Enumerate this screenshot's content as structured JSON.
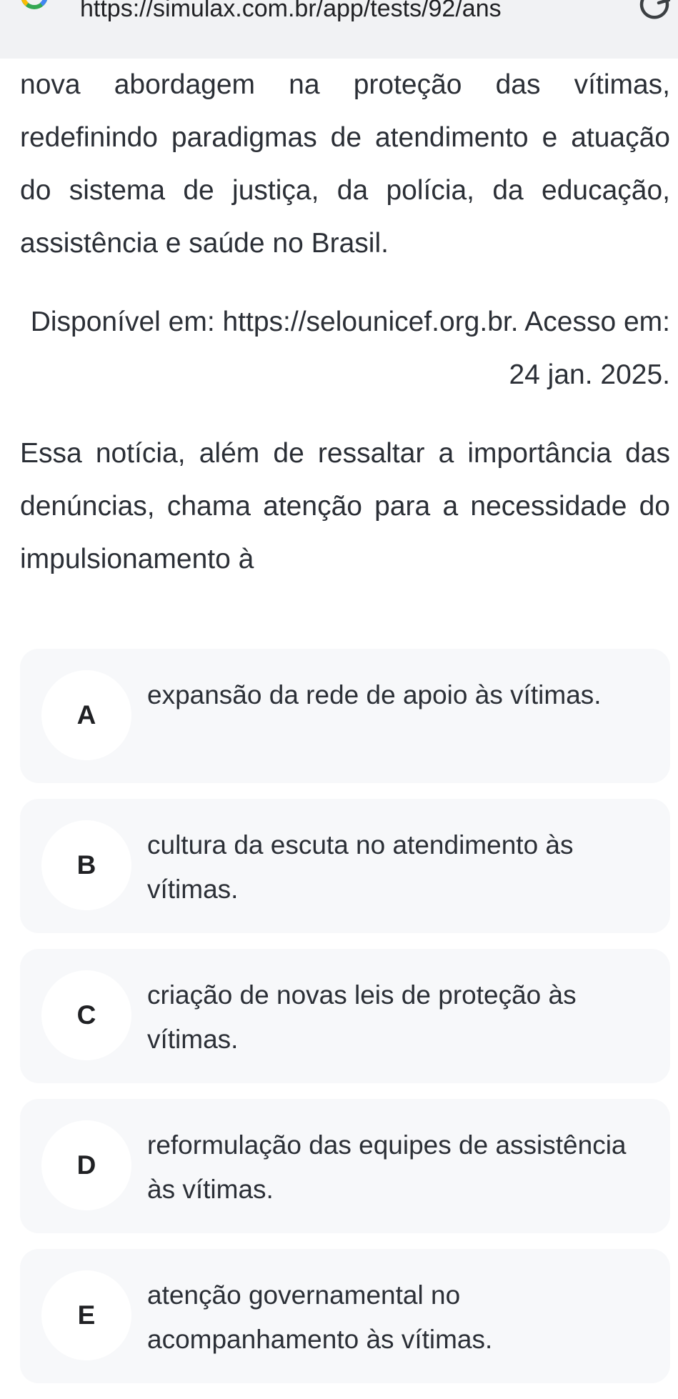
{
  "browser": {
    "url": "https://simulax.com.br/app/tests/92/ans",
    "logo_icon": "google-g-icon",
    "reload_icon": "reload-icon"
  },
  "passage": {
    "paragraph": "nova abordagem na proteção das vítimas, redefinindo paradigmas de atendimento e atuação do sistema de justiça, da polícia, da educação, assistência e saúde no Brasil.",
    "source": "Disponível em: https://selounicef.org.br. Acesso em: 24 jan. 2025."
  },
  "question": {
    "prompt": "Essa notícia, além de ressaltar a importância das denúncias, chama atenção para a necessidade do impulsionamento à"
  },
  "options": [
    {
      "letter": "A",
      "text": "expansão da rede de apoio às vítimas."
    },
    {
      "letter": "B",
      "text": "cultura da escuta no atendimento às vítimas."
    },
    {
      "letter": "C",
      "text": "criação de novas leis de proteção às vítimas."
    },
    {
      "letter": "D",
      "text": "reformulação das equipes de assistência às vítimas."
    },
    {
      "letter": "E",
      "text": "atenção governamental no acompanhamento às vítimas."
    }
  ],
  "colors": {
    "browser_bar": "#f1f2f4",
    "option_bg": "#f7f8fa",
    "text": "#2b2f36"
  }
}
